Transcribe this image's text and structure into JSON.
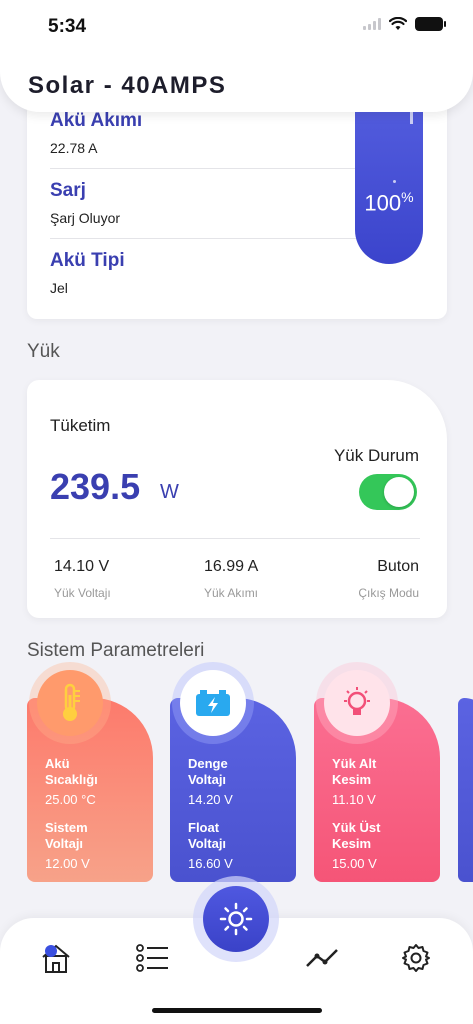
{
  "status_bar": {
    "time": "5:34"
  },
  "header": {
    "title": "Solar - 40AMPS"
  },
  "battery": {
    "rows": [
      {
        "label": "Akü Akımı",
        "value": "22.78 A"
      },
      {
        "label": "Sarj",
        "value": "Şarj Oluyor"
      },
      {
        "label": "Akü Tipi",
        "value": "Jel"
      }
    ],
    "soc": "100",
    "soc_unit": "%"
  },
  "load_section": {
    "title": "Yük",
    "label": "Tüketim",
    "value": "239.5",
    "unit": "W",
    "status_label": "Yük Durum",
    "toggle_on": true,
    "stats": [
      {
        "value": "14.10 V",
        "label": "Yük Voltajı"
      },
      {
        "value": "16.99 A",
        "label": "Yük Akımı"
      },
      {
        "value": "Buton",
        "label": "Çıkış Modu"
      }
    ]
  },
  "params_section": {
    "title": "Sistem Parametreleri",
    "cards": [
      {
        "icon": "thermometer-icon",
        "name1": "Akü\nSıcaklığı",
        "val1": "25.00 °C",
        "name2": "Sistem\nVoltajı",
        "val2": "12.00 V",
        "color": "#fd7a6c"
      },
      {
        "icon": "battery-charge-icon",
        "name1": "Denge\nVoltajı",
        "val1": "14.20 V",
        "name2": "Float\nVoltajı",
        "val2": "16.60 V",
        "color": "#5b63e2"
      },
      {
        "icon": "lightbulb-icon",
        "name1": "Yük Alt\nKesim",
        "val1": "11.10 V",
        "name2": "Yük Üst\nKesim",
        "val2": "15.00 V",
        "color": "#fb6f92"
      }
    ]
  },
  "nav": {
    "items": [
      "home-icon",
      "list-icon",
      "sun-icon",
      "trend-icon",
      "gear-icon"
    ],
    "active": "home-icon"
  },
  "colors": {
    "accent": "#3a3fb0",
    "toggle": "#34c759"
  }
}
